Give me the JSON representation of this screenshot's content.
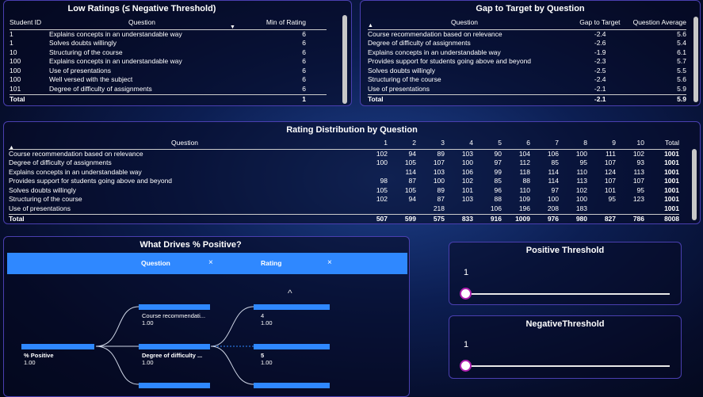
{
  "low_ratings": {
    "title": "Low Ratings (≤ Negative Threshold)",
    "columns": [
      "Student ID",
      "Question",
      "Min of Rating"
    ],
    "rows": [
      {
        "id": "1",
        "q": "Explains concepts in an understandable way",
        "v": "6"
      },
      {
        "id": "1",
        "q": "Solves doubts willingly",
        "v": "6"
      },
      {
        "id": "10",
        "q": "Structuring of the course",
        "v": "6"
      },
      {
        "id": "100",
        "q": "Explains concepts in an understandable way",
        "v": "6"
      },
      {
        "id": "100",
        "q": "Use of presentations",
        "v": "6"
      },
      {
        "id": "100",
        "q": "Well versed with the subject",
        "v": "6"
      },
      {
        "id": "101",
        "q": "Degree of difficulty of assignments",
        "v": "6"
      }
    ],
    "total": {
      "label": "Total",
      "v": "1"
    }
  },
  "gap": {
    "title": "Gap to Target by Question",
    "columns": [
      "Question",
      "Gap to Target",
      "Question Average"
    ],
    "rows": [
      {
        "q": "Course recommendation based on relevance",
        "g": "-2.4",
        "a": "5.6"
      },
      {
        "q": "Degree of difficulty of assignments",
        "g": "-2.6",
        "a": "5.4"
      },
      {
        "q": "Explains concepts in an understandable way",
        "g": "-1.9",
        "a": "6.1"
      },
      {
        "q": "Provides support for students going above and beyond",
        "g": "-2.3",
        "a": "5.7"
      },
      {
        "q": "Solves doubts willingly",
        "g": "-2.5",
        "a": "5.5"
      },
      {
        "q": "Structuring of the course",
        "g": "-2.4",
        "a": "5.6"
      },
      {
        "q": "Use of presentations",
        "g": "-2.1",
        "a": "5.9"
      }
    ],
    "total": {
      "label": "Total",
      "g": "-2.1",
      "a": "5.9"
    }
  },
  "distribution": {
    "title": "Rating Distribution by Question",
    "question_header": "Question",
    "columns": [
      "1",
      "2",
      "3",
      "4",
      "5",
      "6",
      "7",
      "8",
      "9",
      "10",
      "Total"
    ],
    "rows": [
      {
        "q": "Course recommendation based on relevance",
        "v": [
          "102",
          "94",
          "89",
          "103",
          "90",
          "104",
          "106",
          "100",
          "111",
          "102",
          "1001"
        ]
      },
      {
        "q": "Degree of difficulty of assignments",
        "v": [
          "100",
          "105",
          "107",
          "100",
          "97",
          "112",
          "85",
          "95",
          "107",
          "93",
          "1001"
        ]
      },
      {
        "q": "Explains concepts in an understandable way",
        "v": [
          "",
          "114",
          "103",
          "106",
          "99",
          "118",
          "114",
          "110",
          "124",
          "113",
          "1001"
        ]
      },
      {
        "q": "Provides support for students going above and beyond",
        "v": [
          "98",
          "87",
          "100",
          "102",
          "85",
          "88",
          "114",
          "113",
          "107",
          "107",
          "1001"
        ]
      },
      {
        "q": "Solves doubts willingly",
        "v": [
          "105",
          "105",
          "89",
          "101",
          "96",
          "110",
          "97",
          "102",
          "101",
          "95",
          "1001"
        ]
      },
      {
        "q": "Structuring of the course",
        "v": [
          "102",
          "94",
          "87",
          "103",
          "88",
          "109",
          "100",
          "100",
          "95",
          "123",
          "1001"
        ]
      },
      {
        "q": "Use of presentations",
        "v": [
          "",
          "",
          "218",
          "",
          "106",
          "196",
          "208",
          "183",
          "",
          "",
          "1001"
        ]
      }
    ],
    "total": {
      "label": "Total",
      "v": [
        "507",
        "599",
        "575",
        "833",
        "916",
        "1009",
        "976",
        "980",
        "827",
        "786",
        "8008"
      ]
    }
  },
  "drivers": {
    "title": "What Drives % Positive?",
    "levels": [
      {
        "label": "Question",
        "close": "×"
      },
      {
        "label": "Rating",
        "close": "×"
      }
    ],
    "root": {
      "label": "% Positive",
      "value": "1.00"
    },
    "level1": [
      {
        "label": "Course recommendati...",
        "value": "1.00"
      },
      {
        "label": "Degree of difficulty ...",
        "value": "1.00"
      }
    ],
    "level2": [
      {
        "label": "4",
        "value": "1.00"
      },
      {
        "label": "5",
        "value": "1.00"
      }
    ],
    "up_glyph": "^"
  },
  "positive_threshold": {
    "title": "Positive Threshold",
    "value": "1",
    "slider_fraction": 0
  },
  "negative_threshold": {
    "title": "NegativeThreshold",
    "value": "1",
    "slider_fraction": 0
  },
  "colors": {
    "accent": "#2f88ff",
    "panel_border": "#4a3fb0",
    "slider_knob_border": "#b020b0"
  }
}
